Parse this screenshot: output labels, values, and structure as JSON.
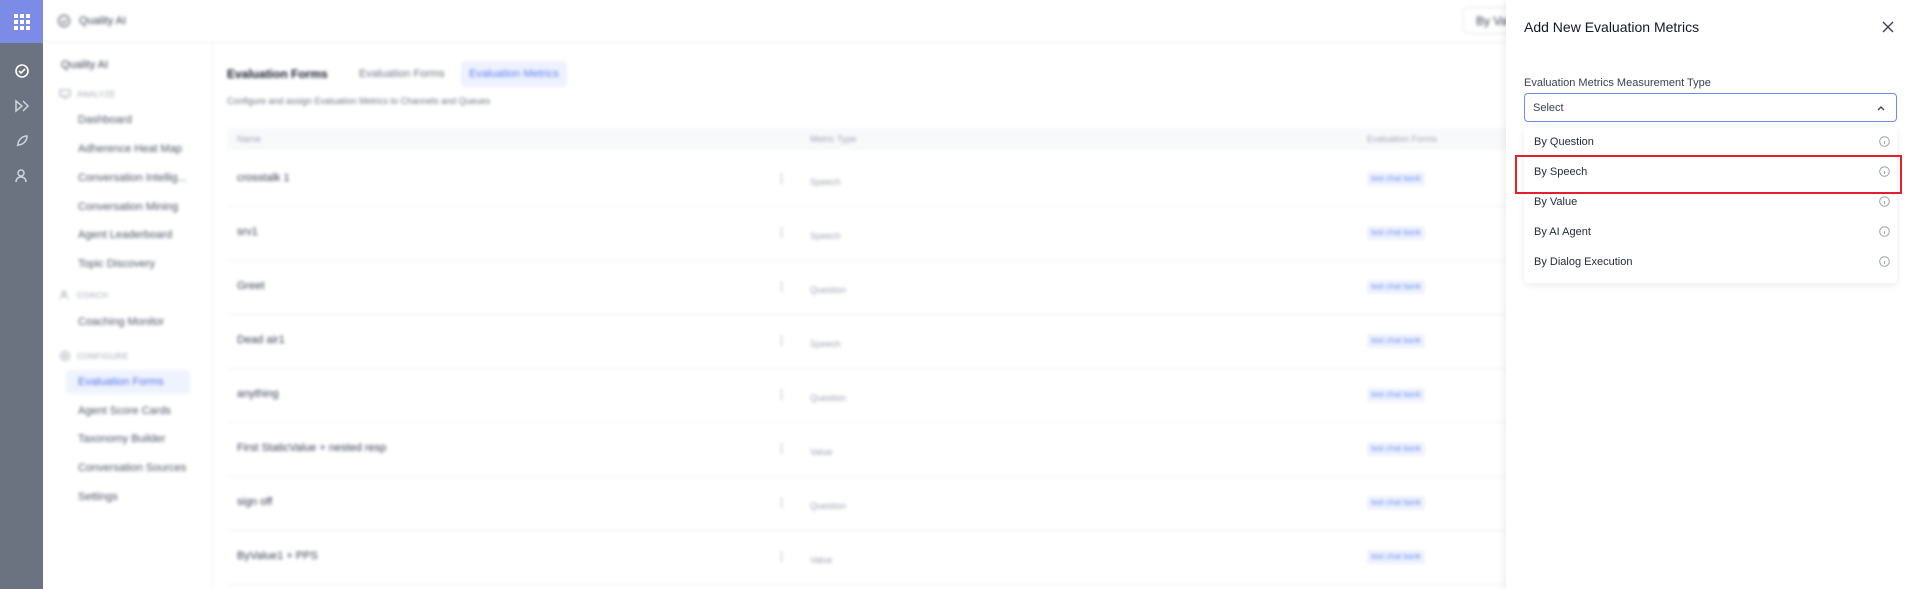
{
  "app": {
    "title": "Quality AI"
  },
  "topbar": {
    "filter_label": "By Value PLAT"
  },
  "sidebar": {
    "title": "Quality AI",
    "sections": [
      {
        "label": "ANALYZE",
        "icon": "monitor-icon"
      },
      {
        "label": "COACH",
        "icon": "person-icon"
      },
      {
        "label": "CONFIGURE",
        "icon": "settings-icon"
      }
    ],
    "items": [
      {
        "label": "Dashboard"
      },
      {
        "label": "Adherence Heat Map"
      },
      {
        "label": "Conversation Intellig..."
      },
      {
        "label": "Conversation Mining"
      },
      {
        "label": "Agent Leaderboard"
      },
      {
        "label": "Topic Discovery"
      },
      {
        "label": "Coaching Monitor"
      },
      {
        "label": "Evaluation Forms"
      },
      {
        "label": "Agent Score Cards"
      },
      {
        "label": "Taxonomy Builder"
      },
      {
        "label": "Conversation Sources"
      },
      {
        "label": "Settings"
      }
    ],
    "active_item": "Evaluation Forms"
  },
  "main": {
    "title": "Evaluation Forms",
    "tabs": [
      {
        "label": "Evaluation Forms"
      },
      {
        "label": "Evaluation Metrics"
      }
    ],
    "active_tab": "Evaluation Metrics",
    "subtitle": "Configure and assign Evaluation Metrics to Channels and Queues",
    "table": {
      "columns": [
        "Name",
        "Metric Type",
        "Evaluation Forms"
      ],
      "rows": [
        {
          "name": "crosstalk 1",
          "type": "Speech",
          "form": "test chat bank"
        },
        {
          "name": "srv1",
          "type": "Speech",
          "form": "test chat bank"
        },
        {
          "name": "Greet",
          "type": "Question",
          "form": "test chat bank"
        },
        {
          "name": "Dead air1",
          "type": "Speech",
          "form": "test chat bank"
        },
        {
          "name": "anything",
          "type": "Question",
          "form": "test chat bank"
        },
        {
          "name": "First StaticValue + nested resp",
          "type": "Value",
          "form": "test chat bank"
        },
        {
          "name": "sign off",
          "type": "Question",
          "form": "test chat bank"
        },
        {
          "name": "ByValue1 + PPS",
          "type": "Value",
          "form": "test chat bank"
        }
      ]
    }
  },
  "panel": {
    "title": "Add New Evaluation Metrics",
    "field_label": "Evaluation Metrics Measurement Type",
    "select_placeholder": "Select",
    "options": [
      {
        "label": "By Question"
      },
      {
        "label": "By Speech"
      },
      {
        "label": "By Value"
      },
      {
        "label": "By AI Agent"
      },
      {
        "label": "By Dialog Execution"
      }
    ],
    "highlighted_option": "By Speech"
  },
  "colors": {
    "accent": "#5b7df0",
    "highlight": "#e3202a",
    "rail": "#6b7280",
    "apps_tile": "#7c8ce6"
  }
}
